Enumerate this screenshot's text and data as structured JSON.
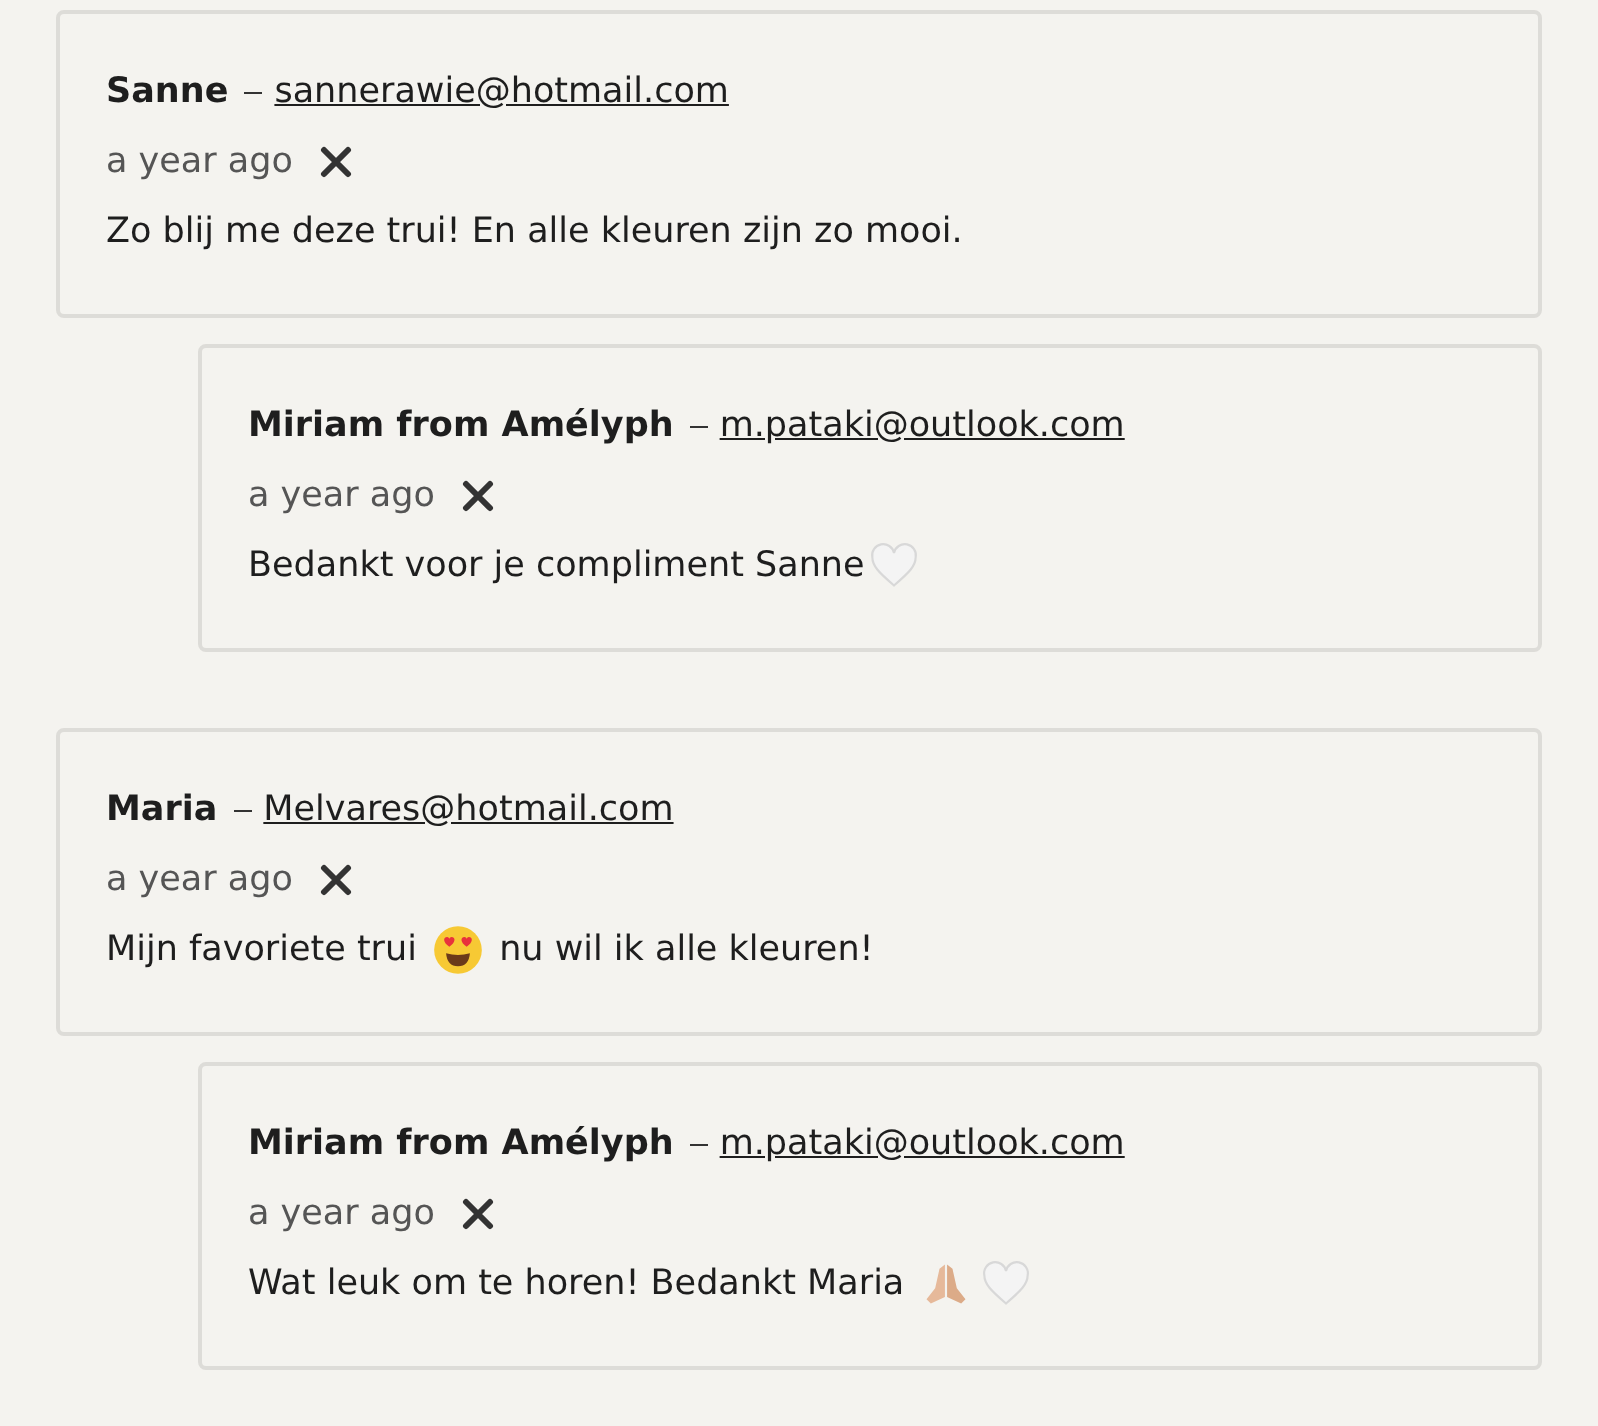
{
  "comments": [
    {
      "author": "Sanne",
      "email": "sannerawie@hotmail.com",
      "time": "a year ago",
      "body": [
        {
          "kind": "text",
          "text": "Zo blij me deze trui! En alle kleuren zijn zo mooi."
        }
      ],
      "replies": [
        {
          "author": "Miriam from Amélyph",
          "email": "m.pataki@outlook.com",
          "time": "a year ago",
          "body": [
            {
              "kind": "text",
              "text": "Bedankt voor je compliment Sanne"
            },
            {
              "kind": "heart"
            }
          ]
        }
      ]
    },
    {
      "author": "Maria",
      "email": "Melvares@hotmail.com",
      "time": "a year ago",
      "body": [
        {
          "kind": "text",
          "text": "Mijn favoriete trui "
        },
        {
          "kind": "heart-eyes"
        },
        {
          "kind": "text",
          "text": " nu wil ik alle kleuren!"
        }
      ],
      "replies": [
        {
          "author": "Miriam from Amélyph",
          "email": "m.pataki@outlook.com",
          "time": "a year ago",
          "body": [
            {
              "kind": "text",
              "text": "Wat leuk om te horen! Bedankt Maria "
            },
            {
              "kind": "praying-hands"
            },
            {
              "kind": "heart"
            }
          ]
        }
      ]
    }
  ]
}
